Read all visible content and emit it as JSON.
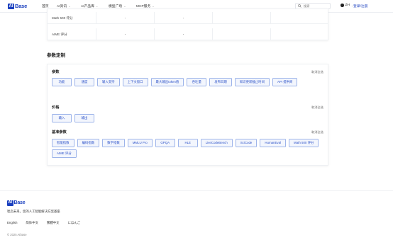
{
  "nav": {
    "logo_mark": "AI",
    "logo_text": "Base",
    "items": [
      {
        "label": "首页",
        "has_menu": false
      },
      {
        "label": "AI资讯",
        "has_menu": true
      },
      {
        "label": "AI产品库",
        "has_menu": true
      },
      {
        "label": "模型广场",
        "has_menu": true
      },
      {
        "label": "MCP服务",
        "has_menu": true
      }
    ],
    "search_placeholder": "搜索",
    "language": "ZH",
    "login": "登录/注册"
  },
  "table": {
    "rows": [
      {
        "name": "Math 500 评分",
        "cells": [
          "-",
          "-",
          "",
          ""
        ]
      },
      {
        "name": "AIME 评分",
        "cells": [
          "-",
          "-",
          "",
          ""
        ]
      }
    ]
  },
  "section_title": "参数定制",
  "groups": {
    "basic": {
      "title": "参数",
      "clear": "取消全选",
      "chips": [
        "功能",
        "速度",
        "输入支持",
        "上下文窗口",
        "最大输出token值",
        "吞吐量",
        "发布日期",
        "知识更新截止时间",
        "API 提供商"
      ]
    },
    "price": {
      "title": "价格",
      "clear": "取消全选",
      "chips": [
        "输入",
        "输出"
      ]
    },
    "bench": {
      "title": "基准参数",
      "clear": "取消全选",
      "chips": [
        "智能指数",
        "编码指数",
        "数学指数",
        "MMLU Pro",
        "GPQA",
        "HLE",
        "LiveCodeBench",
        "SciCode",
        "HumanEval",
        "Math 500 评分",
        "AIME 评分"
      ]
    }
  },
  "footer": {
    "logo_mark": "AI",
    "logo_text": "Base",
    "tagline": "智启未来，您的人工智能解决方案基座",
    "languages": [
      "English",
      "简体中文",
      "繁體中文",
      "にほんご"
    ],
    "copyright": "© 2025 AIbase"
  },
  "colors": {
    "brand": "#1a3fbf",
    "chip_border": "#9db4ea",
    "chip_bg": "#f3f6fd",
    "chip_text": "#2a50c8"
  }
}
